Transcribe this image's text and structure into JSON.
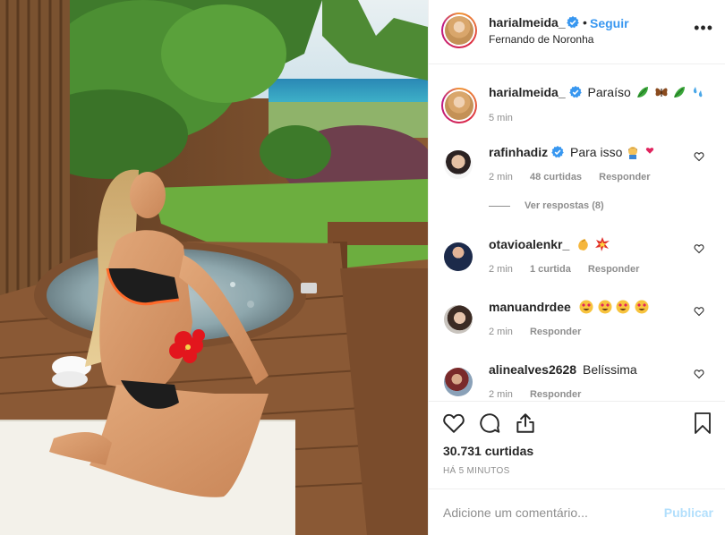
{
  "post": {
    "username": "harialmeida_",
    "follow_label": "Seguir",
    "location": "Fernando de Noronha",
    "caption_text": "Paraíso",
    "caption_time": "5 min"
  },
  "comments": [
    {
      "user": "rafinhadiz",
      "verified": true,
      "text": "Para isso",
      "time": "2 min",
      "likes": "48 curtidas",
      "reply": "Responder",
      "view_replies": "Ver respostas (8)"
    },
    {
      "user": "otavioalenkr_",
      "verified": false,
      "text": "",
      "time": "2 min",
      "likes": "1 curtida",
      "reply": "Responder"
    },
    {
      "user": "manuandrdee",
      "verified": false,
      "text": "",
      "time": "2 min",
      "reply": "Responder"
    },
    {
      "user": "alinealves2628",
      "verified": false,
      "text": "Belíssima",
      "time": "2 min",
      "reply": "Responder"
    }
  ],
  "actions": {
    "likes_count": "30.731 curtidas",
    "time_ago": "Há 5 minutos"
  },
  "add_comment": {
    "placeholder": "Adicione um comentário...",
    "publish_label": "Publicar"
  },
  "colors": {
    "accent": "#3897f0",
    "publish_disabled": "#b2dffc",
    "meta_gray": "#8e8e8e"
  },
  "icons": [
    "more-options-icon",
    "verified-icon",
    "heart-icon",
    "comment-icon",
    "share-icon",
    "bookmark-icon"
  ]
}
